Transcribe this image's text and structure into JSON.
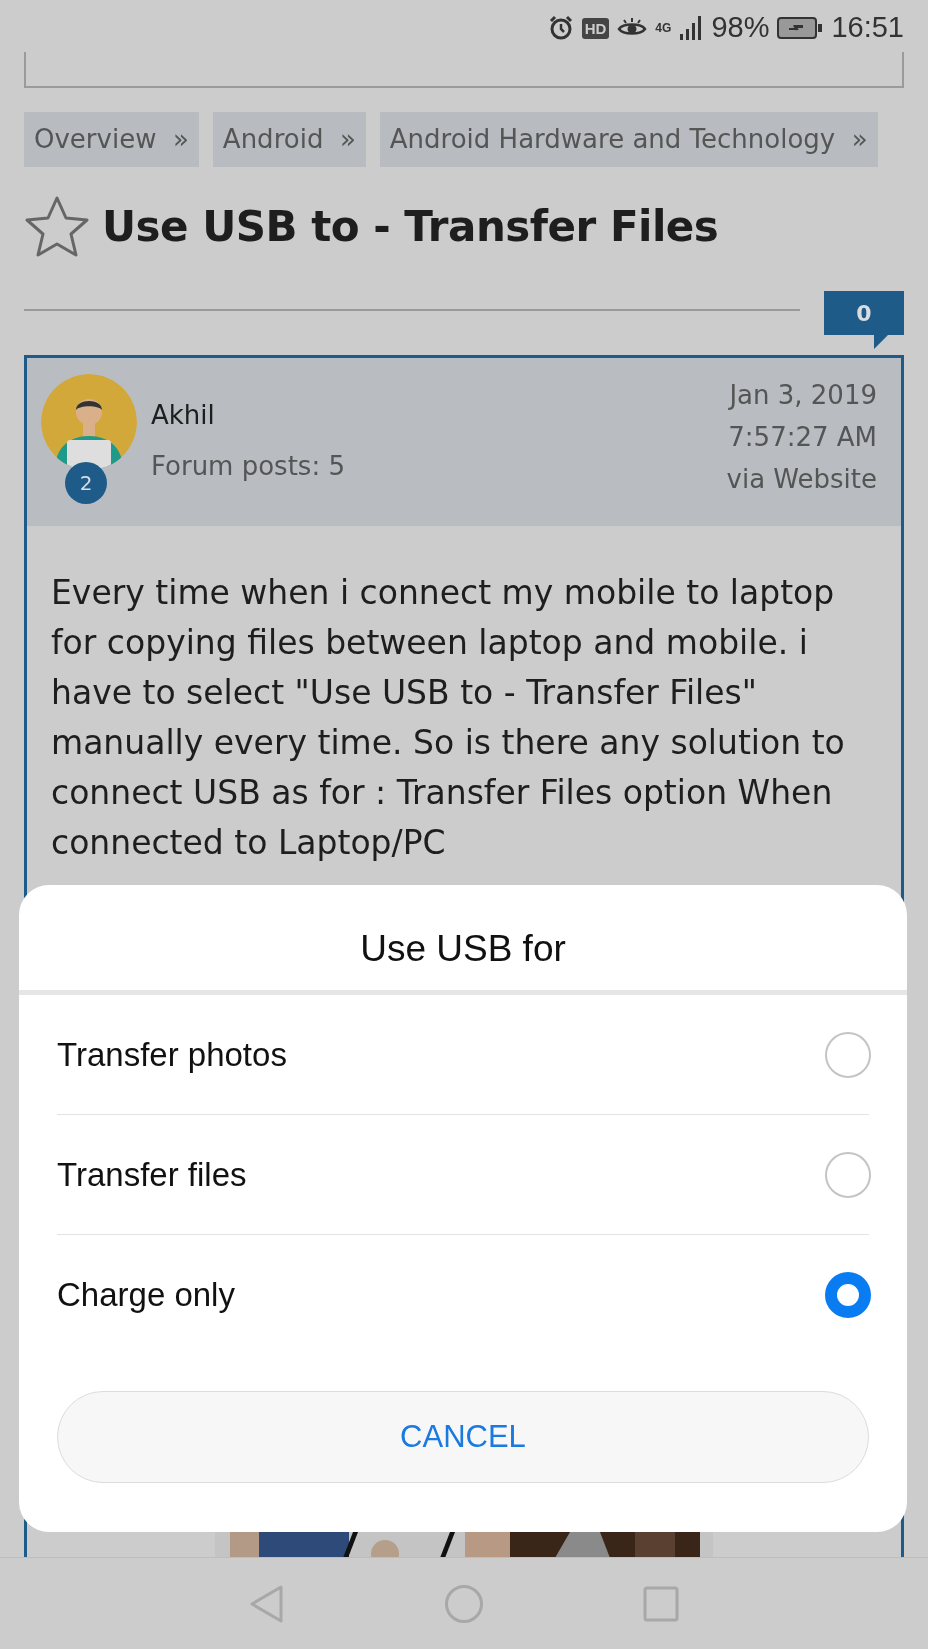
{
  "status_bar": {
    "hd_badge": "HD",
    "network": "4G",
    "battery": "98%",
    "time": "16:51"
  },
  "breadcrumbs": [
    {
      "label": "Overview",
      "separator": "»"
    },
    {
      "label": "Android",
      "separator": "»"
    },
    {
      "label": "Android Hardware and Technology",
      "separator": "»"
    }
  ],
  "thread": {
    "title": "Use USB to - Transfer Files",
    "reply_count": "0"
  },
  "post": {
    "author": "Akhil",
    "forum_posts": "Forum posts: 5",
    "rank": "2",
    "date": "Jan 3, 2019",
    "time": "7:57:27 AM",
    "source": "via Website",
    "body": "Every time when i connect my mobile to laptop for copying files between laptop and mobile. i have to select \"Use USB to - Transfer Files\" manually every time. So is there any solution to connect USB as for : Transfer Files option When connected to Laptop/PC"
  },
  "dialog": {
    "title": "Use USB for",
    "options": [
      {
        "label": "Transfer photos",
        "selected": false
      },
      {
        "label": "Transfer files",
        "selected": false
      },
      {
        "label": "Charge only",
        "selected": true
      }
    ],
    "cancel": "CANCEL"
  }
}
